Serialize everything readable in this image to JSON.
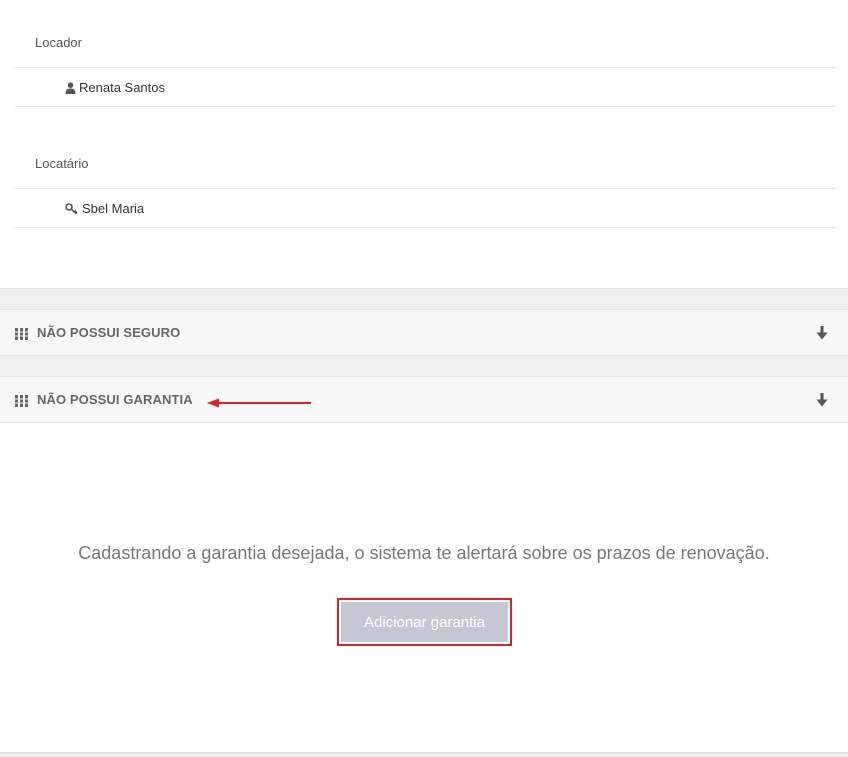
{
  "parties": {
    "landlord_label": "Locador",
    "landlord_name": "Renata Santos",
    "tenant_label": "Locatário",
    "tenant_name": "Sbel Maria"
  },
  "accordions": [
    {
      "title": "NÃO POSSUI SEGURO",
      "icon": "grid-icon",
      "toggle_icon": "arrow-down-icon"
    },
    {
      "title": "NÃO POSSUI GARANTIA",
      "icon": "grid-icon",
      "toggle_icon": "arrow-down-icon"
    }
  ],
  "guarantee": {
    "info_text": "Cadastrando a garantia desejada, o sistema te alertará sobre os prazos de renovação.",
    "add_button_label": "Adicionar garantia"
  },
  "colors": {
    "annotation_red": "#e02020",
    "button_bg": "#c5c7d2"
  }
}
